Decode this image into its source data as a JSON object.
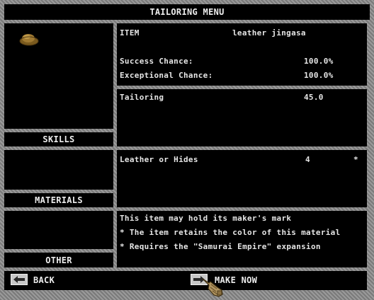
{
  "window": {
    "title": "TAILORING MENU"
  },
  "item": {
    "label": "ITEM",
    "name": "leather jingasa"
  },
  "chances": [
    {
      "label": "Success Chance:",
      "value": "100.0%"
    },
    {
      "label": "Exceptional Chance:",
      "value": "100.0%"
    }
  ],
  "skills": {
    "heading": "SKILLS",
    "rows": [
      {
        "name": "Tailoring",
        "value": "45.0"
      }
    ]
  },
  "materials": {
    "heading": "MATERIALS",
    "rows": [
      {
        "name": "Leather or Hides",
        "amount": "4",
        "mark": "*"
      }
    ]
  },
  "other": {
    "heading": "OTHER",
    "notes": [
      "This item may hold its maker's mark",
      "* The item retains the color of this material",
      "* Requires the \"Samurai Empire\" expansion"
    ]
  },
  "buttons": {
    "back": "BACK",
    "make_now": "MAKE NOW"
  },
  "icons": {
    "item_preview": "leather-jingasa-icon",
    "back": "back-arrow-icon",
    "make": "make-arrow-icon",
    "cursor": "gauntlet-cursor-icon"
  }
}
